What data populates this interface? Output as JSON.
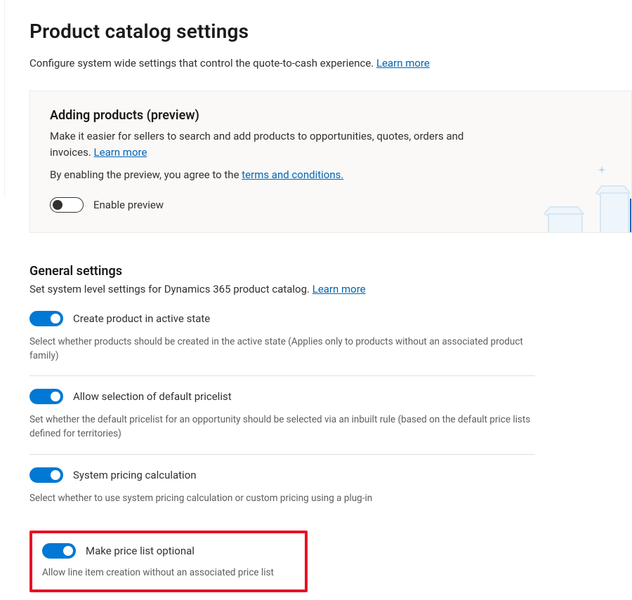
{
  "header": {
    "title": "Product catalog settings",
    "intro": "Configure system wide settings that control the quote-to-cash experience.",
    "learn_more": "Learn more"
  },
  "preview_panel": {
    "heading": "Adding products (preview)",
    "body": "Make it easier for sellers to search and add products to opportunities, quotes, orders and invoices.",
    "learn_more": "Learn more",
    "agree_prefix": "By enabling the preview, you agree to the ",
    "terms_link": "terms and conditions.",
    "toggle_label": "Enable preview",
    "toggle_on": false
  },
  "general": {
    "heading": "General settings",
    "sub": "Set system level settings for Dynamics 365 product catalog.",
    "learn_more": "Learn more",
    "settings": [
      {
        "label": "Create product in active state",
        "on": true,
        "desc": "Select whether products should be created in the active state (Applies only to products without an associated product family)"
      },
      {
        "label": "Allow selection of default pricelist",
        "on": true,
        "desc": "Set whether the default pricelist for an opportunity should be selected via an inbuilt rule (based on the default price lists defined for territories)"
      },
      {
        "label": "System pricing calculation",
        "on": true,
        "desc": "Select whether to use system pricing calculation or custom pricing using a plug-in"
      },
      {
        "label": "Make price list optional",
        "on": true,
        "desc": "Allow line item creation without an associated price list",
        "highlighted": true
      }
    ]
  }
}
